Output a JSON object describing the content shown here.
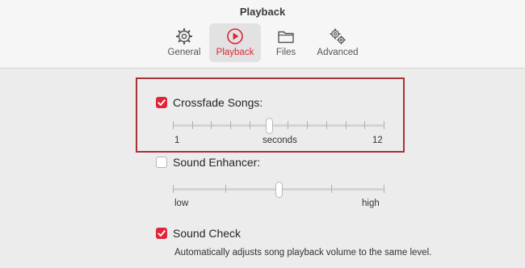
{
  "window": {
    "title": "Playback"
  },
  "tabs": [
    {
      "id": "general",
      "label": "General",
      "icon": "gear-icon",
      "active": false
    },
    {
      "id": "playback",
      "label": "Playback",
      "icon": "play-circle-icon",
      "active": true
    },
    {
      "id": "files",
      "label": "Files",
      "icon": "folder-icon",
      "active": false
    },
    {
      "id": "advanced",
      "label": "Advanced",
      "icon": "gears-icon",
      "active": false
    }
  ],
  "colors": {
    "accent": "#e0243a",
    "highlight_frame": "#a8323a"
  },
  "crossfade": {
    "label": "Crossfade Songs:",
    "checked": true,
    "min_label": "1",
    "unit_label": "seconds",
    "max_label": "12",
    "min": 1,
    "max": 12,
    "value": 6
  },
  "sound_enhancer": {
    "label": "Sound Enhancer:",
    "checked": false,
    "min_label": "low",
    "max_label": "high",
    "level": 0.5
  },
  "sound_check": {
    "label": "Sound Check",
    "checked": true,
    "description": "Automatically adjusts song playback volume to the same level."
  }
}
